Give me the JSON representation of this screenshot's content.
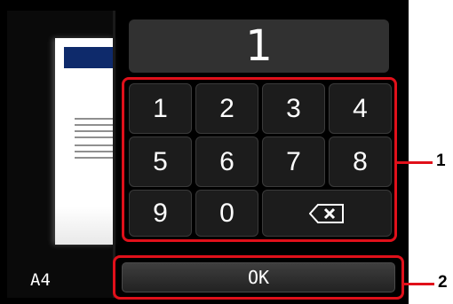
{
  "display": {
    "value": "1"
  },
  "preview": {
    "paper_size": "A4"
  },
  "keypad": {
    "keys": [
      "1",
      "2",
      "3",
      "4",
      "5",
      "6",
      "7",
      "8",
      "9",
      "0"
    ],
    "backspace_icon": "backspace-icon"
  },
  "ok_button": {
    "label": "OK"
  },
  "callouts": {
    "keypad": "1",
    "ok": "2"
  },
  "colors": {
    "screen_bg": "#000000",
    "key_bg": "#1c1c1c",
    "highlight": "#e0101a",
    "text": "#ffffff"
  }
}
